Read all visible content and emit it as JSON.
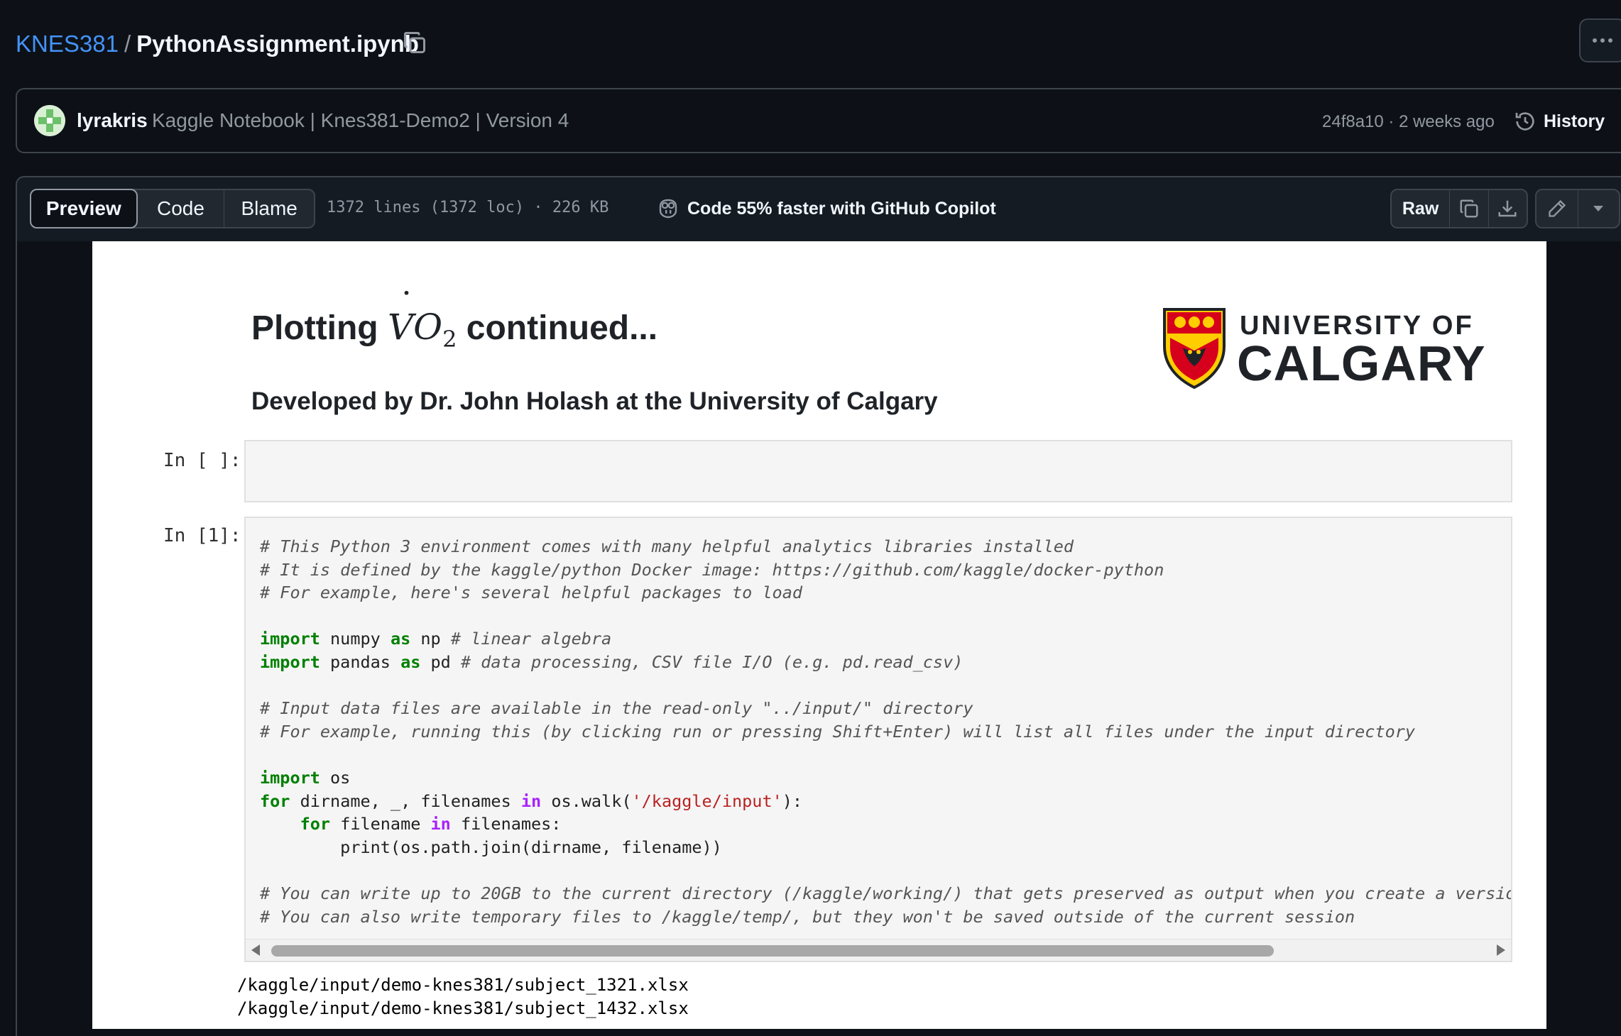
{
  "breadcrumb": {
    "repo": "KNES381",
    "separator": "/",
    "file": "PythonAssignment.ipynb"
  },
  "commit": {
    "author": "lyrakris",
    "message": "Kaggle Notebook | Knes381-Demo2 | Version 4",
    "sha_time": "24f8a10 · 2 weeks ago",
    "history_label": "History"
  },
  "toolbar": {
    "tabs": [
      "Preview",
      "Code",
      "Blame"
    ],
    "lines_info": "1372 lines (1372 loc) · 226 KB",
    "copilot": "Code 55% faster with GitHub Copilot",
    "raw_label": "Raw"
  },
  "notebook": {
    "title_pre": "Plotting",
    "title_math_var": "V",
    "title_math_o": "O",
    "title_math_sub": "2",
    "title_post": "continued...",
    "subtitle": "Developed by Dr. John Holash at the University of Calgary",
    "logo_line1": "UNIVERSITY OF",
    "logo_line2": "CALGARY",
    "cells": [
      {
        "prompt": "In [ ]:"
      },
      {
        "prompt": "In [1]:"
      }
    ],
    "output_lines": [
      "/kaggle/input/demo-knes381/subject_1321.xlsx",
      "/kaggle/input/demo-knes381/subject_1432.xlsx"
    ]
  },
  "colors": {
    "link": "#4493f8",
    "background": "#0d1117",
    "border": "#3d444d",
    "calgary_red": "#d6001c",
    "calgary_gold": "#ffcd00"
  },
  "icons": [
    "copy-icon",
    "kebab-icon",
    "history-icon",
    "copilot-icon",
    "download-icon",
    "pencil-icon",
    "chevron-down-icon"
  ]
}
